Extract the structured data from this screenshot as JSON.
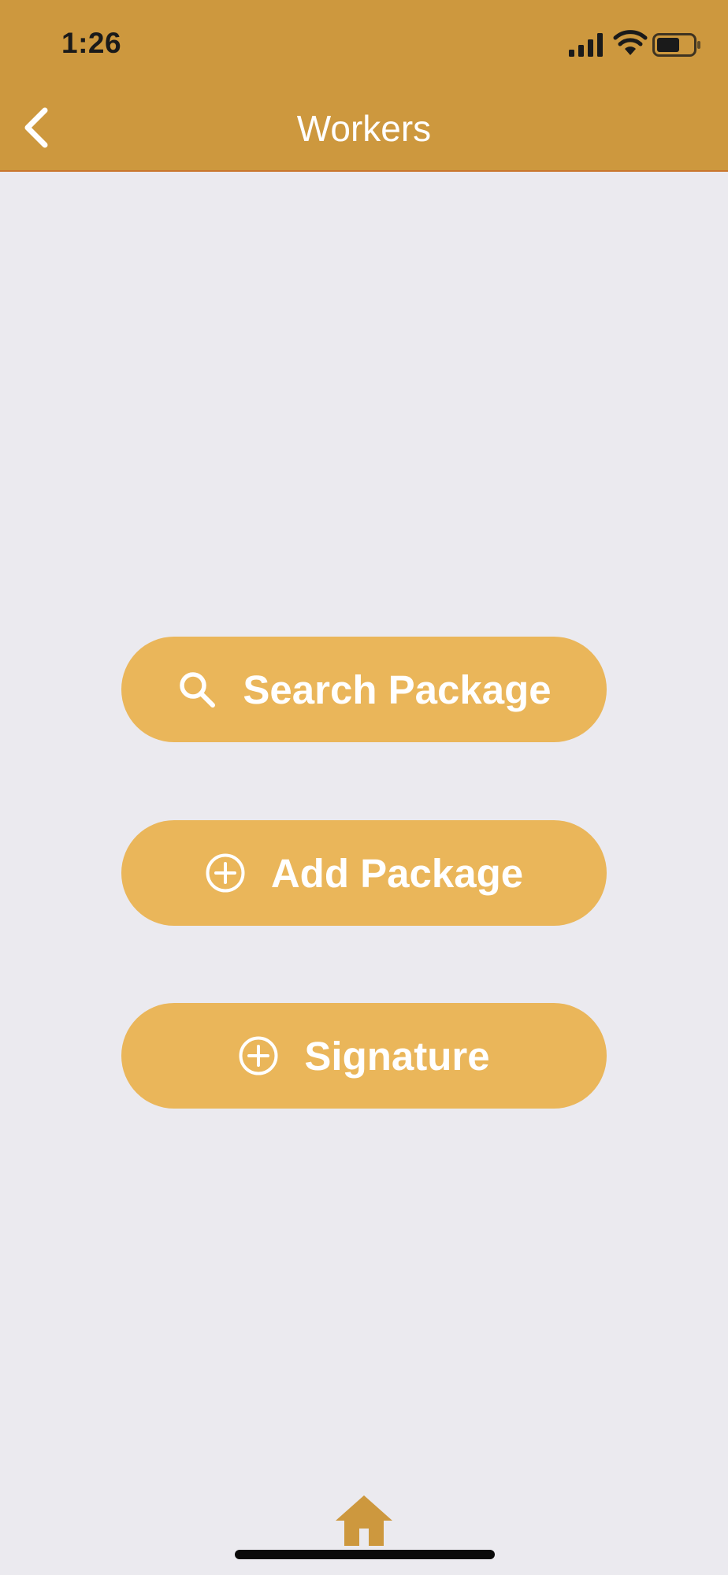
{
  "status_bar": {
    "time": "1:26"
  },
  "nav": {
    "title": "Workers",
    "back_icon": "chevron-left-icon"
  },
  "actions": [
    {
      "label": "Search Package",
      "icon": "search-icon"
    },
    {
      "label": "Add Package",
      "icon": "plus-circle-icon"
    },
    {
      "label": "Signature",
      "icon": "plus-circle-icon"
    }
  ],
  "bottom": {
    "home_icon": "home-icon"
  },
  "colors": {
    "header": "#CD983E",
    "button": "#EAB65A",
    "background": "#EBEAEF",
    "home_icon": "#CD983E"
  }
}
